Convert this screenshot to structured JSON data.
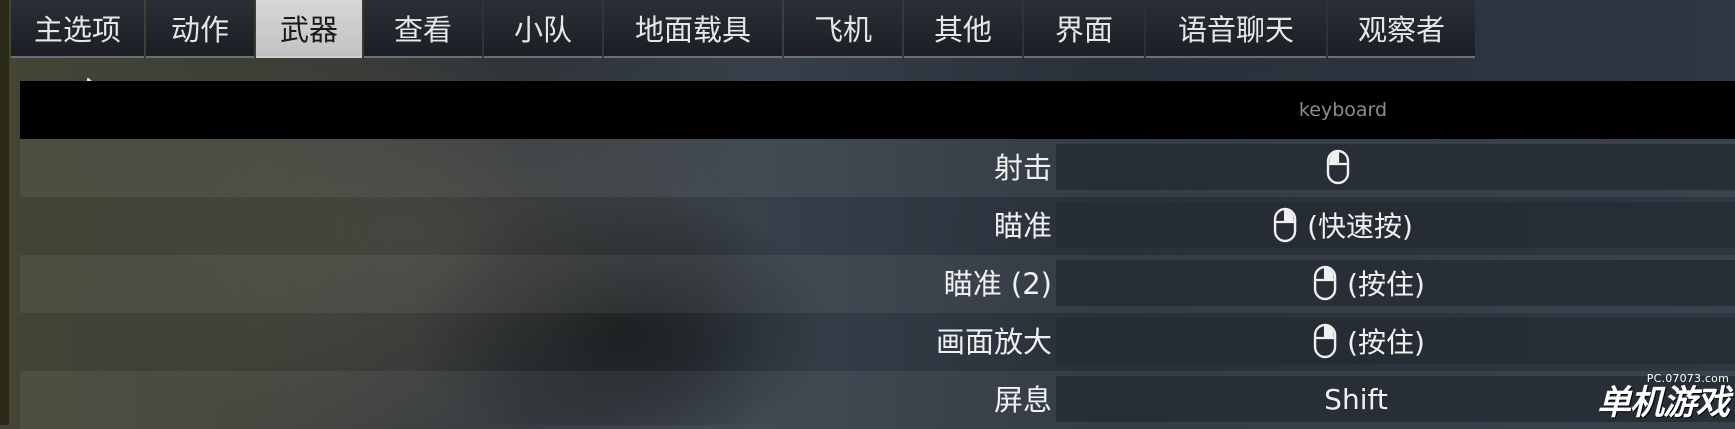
{
  "tabs": [
    {
      "label": "主选项",
      "active": false
    },
    {
      "label": "动作",
      "active": false
    },
    {
      "label": "武器",
      "active": true
    },
    {
      "label": "查看",
      "active": false
    },
    {
      "label": "小队",
      "active": false
    },
    {
      "label": "地面载具",
      "active": false
    },
    {
      "label": "飞机",
      "active": false
    },
    {
      "label": "其他",
      "active": false
    },
    {
      "label": "界面",
      "active": false
    },
    {
      "label": "语音聊天",
      "active": false
    },
    {
      "label": "观察者",
      "active": false
    }
  ],
  "table": {
    "column_header": "keyboard",
    "rows": [
      {
        "action": "射击",
        "mouse_icon": "mouse-left-button-icon",
        "binding": ""
      },
      {
        "action": "瞄准",
        "mouse_icon": "mouse-right-button-icon",
        "binding": "(快速按)"
      },
      {
        "action": "瞄准 (2)",
        "mouse_icon": "mouse-right-button-icon",
        "binding": "(按住)"
      },
      {
        "action": "画面放大",
        "mouse_icon": "mouse-right-button-icon",
        "binding": "(按住)"
      },
      {
        "action": "屏息",
        "mouse_icon": "",
        "binding": "Shift"
      }
    ]
  },
  "watermark": {
    "url": "PC.07073.com",
    "name": "单机游戏"
  },
  "colors": {
    "active_tab": "#d0d0d0",
    "tab_bg": "#22272e",
    "header_bg": "#000000"
  }
}
